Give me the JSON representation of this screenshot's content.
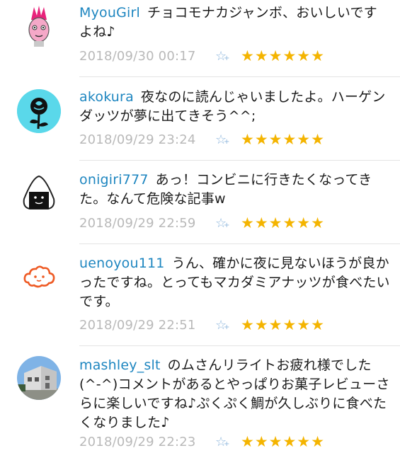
{
  "comments": [
    {
      "username": "MyouGirl",
      "text": "チョコモナカジャンボ、おいしいですよね♪",
      "timestamp": "2018/09/30 00:17",
      "stars": "★★★★★★",
      "fav_icon": "star-plus-icon",
      "avatar": "pink-mohawk-face"
    },
    {
      "username": "akokura",
      "text": "夜なのに読んじゃいましたよ。ハーゲンダッツが夢に出てきそう^^;",
      "timestamp": "2018/09/29 23:24",
      "stars": "★★★★★★",
      "fav_icon": "star-plus-icon",
      "avatar": "black-rose-on-cyan"
    },
    {
      "username": "onigiri777",
      "text": "あっ！コンビニに行きたくなってきた。なんて危険な記事w",
      "timestamp": "2018/09/29 22:59",
      "stars": "★★★★★★",
      "fav_icon": "star-plus-icon",
      "avatar": "onigiri-face"
    },
    {
      "username": "uenoyou111",
      "text": "うん、確かに夜に見ないほうが良かったですね。とってもマカダミアナッツが食べたいです。",
      "timestamp": "2018/09/29 22:51",
      "stars": "★★★★★★",
      "fav_icon": "star-plus-icon",
      "avatar": "orange-cloud-face"
    },
    {
      "username": "mashley_slt",
      "text": "のムさんリライトお疲れ様でした(^-^)コメントがあるとやっぱりお菓子レビューさらに楽しいですね♪ぷくぷく鯛が久しぶりに食べたくなりました♪",
      "timestamp": "2018/09/29 22:23",
      "stars": "★★★★★★",
      "fav_icon": "star-plus-icon",
      "avatar": "house-photo"
    }
  ]
}
